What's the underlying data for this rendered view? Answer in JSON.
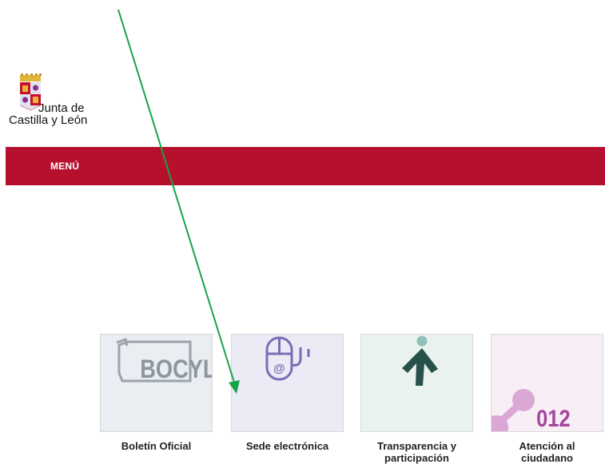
{
  "header": {
    "logo_line1": "Junta de",
    "logo_line2": "Castilla y León"
  },
  "nav": {
    "menu_label": "MENÚ"
  },
  "tiles": [
    {
      "label": "Boletín Oficial",
      "graphic_text": "BOCYL",
      "icon": "bocyl-icon"
    },
    {
      "label": "Sede electrónica",
      "graphic_text": "@",
      "icon": "mouse-at-icon"
    },
    {
      "label_line1": "Transparencia y",
      "label_line2": "participación",
      "icon": "person-arrow-icon"
    },
    {
      "label_line1": "Atención al",
      "label_line2": "ciudadano",
      "graphic_text": "012",
      "icon": "phone-012-icon"
    }
  ],
  "colors": {
    "menu_bar": "#b5102d",
    "annotation_arrow": "#16a34a",
    "tile1_bg": "#eaedf1",
    "tile2_bg": "#ebebf6",
    "tile3_bg": "#e9f2ef",
    "tile4_bg": "#f7eef6"
  }
}
